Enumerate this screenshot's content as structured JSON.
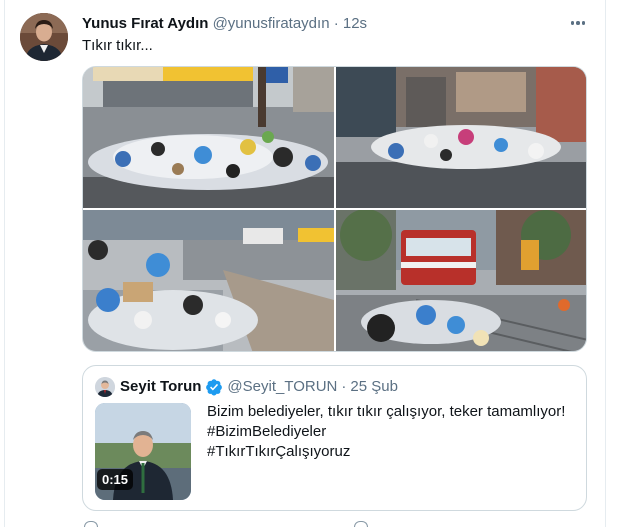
{
  "tweet": {
    "author_name": "Yunus Fırat Aydın",
    "author_handle": "@yunusfirataydın",
    "separator": "·",
    "time": "12s",
    "text": "Tıkır tıkır..."
  },
  "quoted_tweet": {
    "author_name": "Seyit Torun",
    "author_handle": "@Seyit_TORUN",
    "separator": "·",
    "time": "25 Şub",
    "video_duration": "0:15",
    "lines": [
      "Bizim belediyeler, tıkır tıkır çalışıyor, teker tamamlıyor!",
      "#BizimBelediyeler",
      "#TıkırTıkırÇalışıyoruz"
    ]
  },
  "colors": {
    "text_primary": "#0f1419",
    "text_secondary": "#5b7083",
    "border": "#cfd9de",
    "verified": "#1d9bf0"
  },
  "icons": {
    "more": "more-horizontal-icon",
    "verified": "verified-badge-icon"
  }
}
